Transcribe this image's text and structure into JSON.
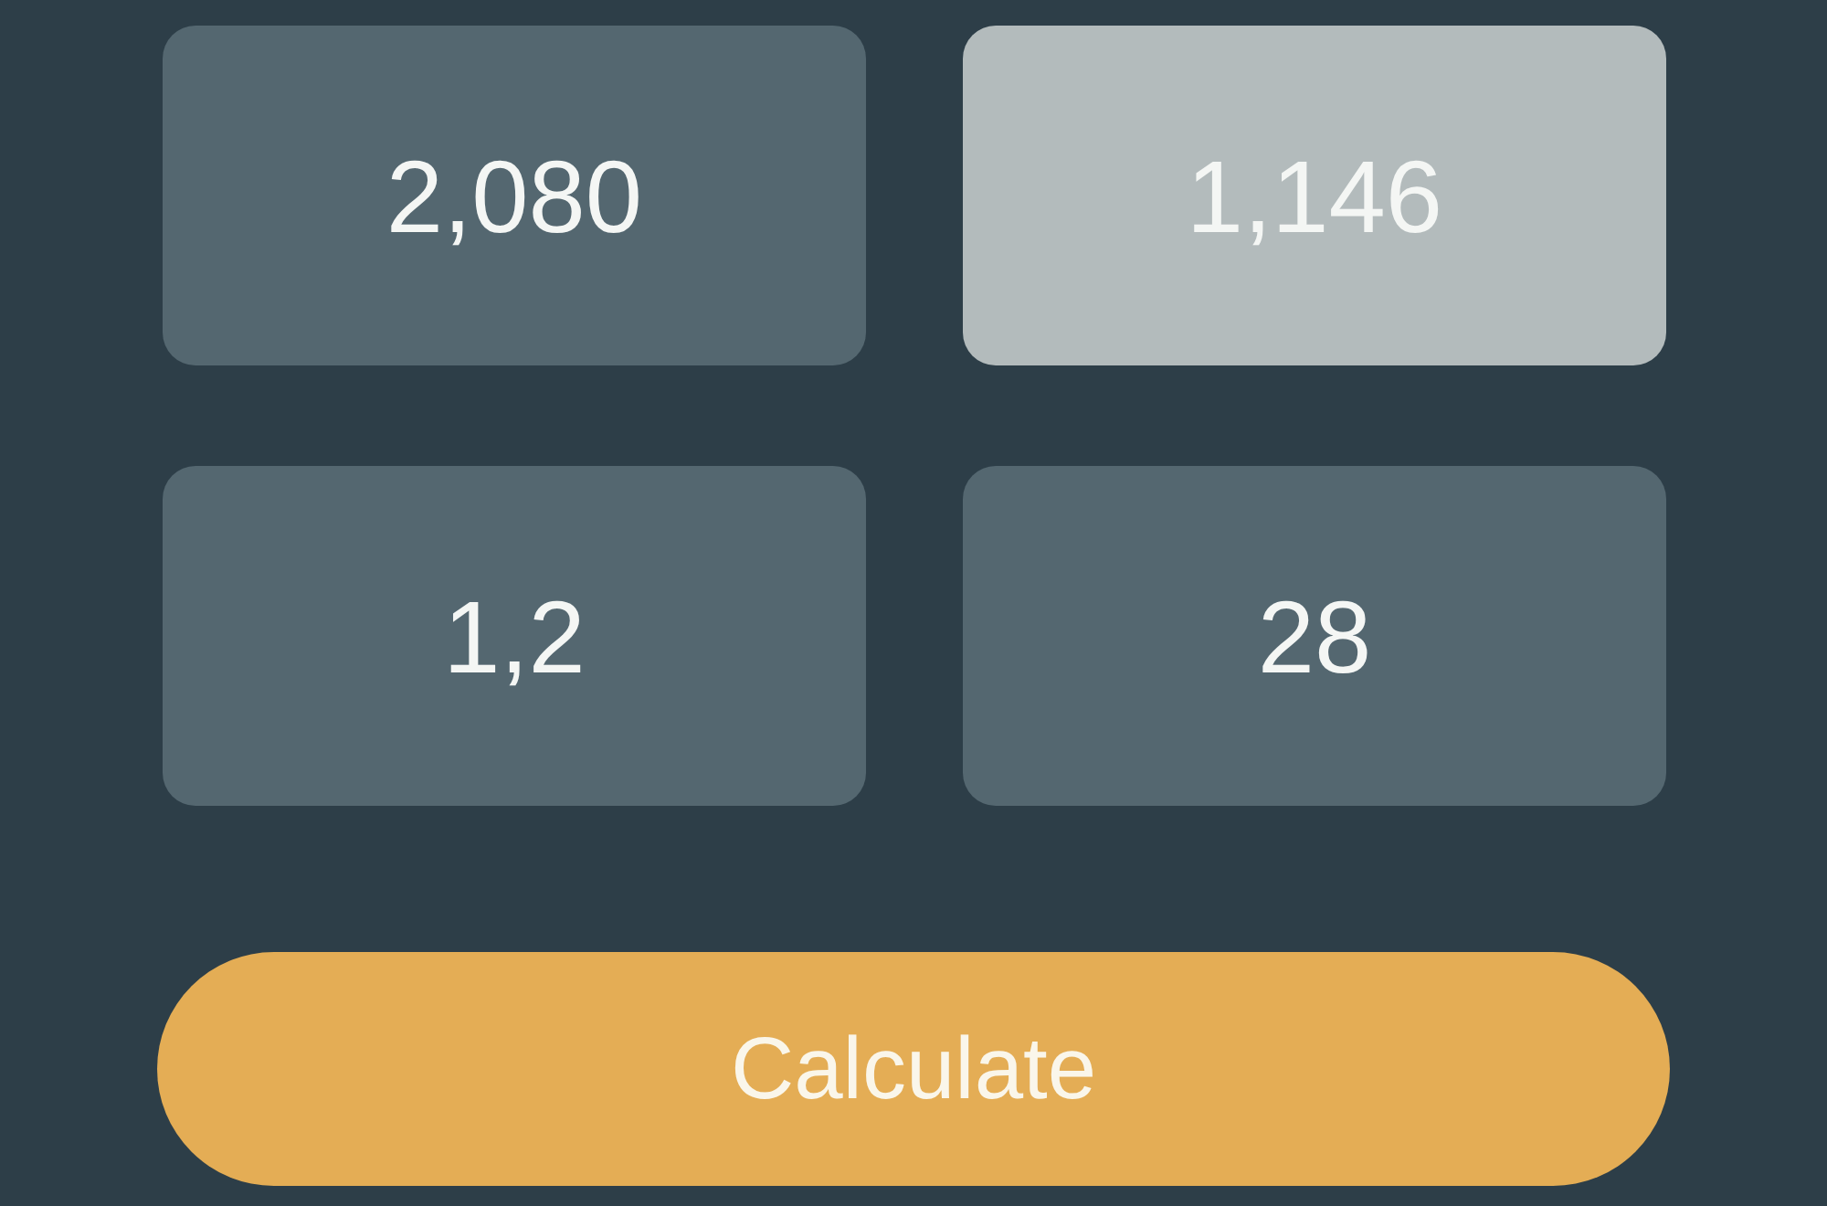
{
  "tiles": [
    {
      "value": "2,080",
      "selected": false
    },
    {
      "value": "1,146",
      "selected": true
    },
    {
      "value": "1,2",
      "selected": false
    },
    {
      "value": "28",
      "selected": false
    }
  ],
  "button": {
    "label": "Calculate"
  }
}
